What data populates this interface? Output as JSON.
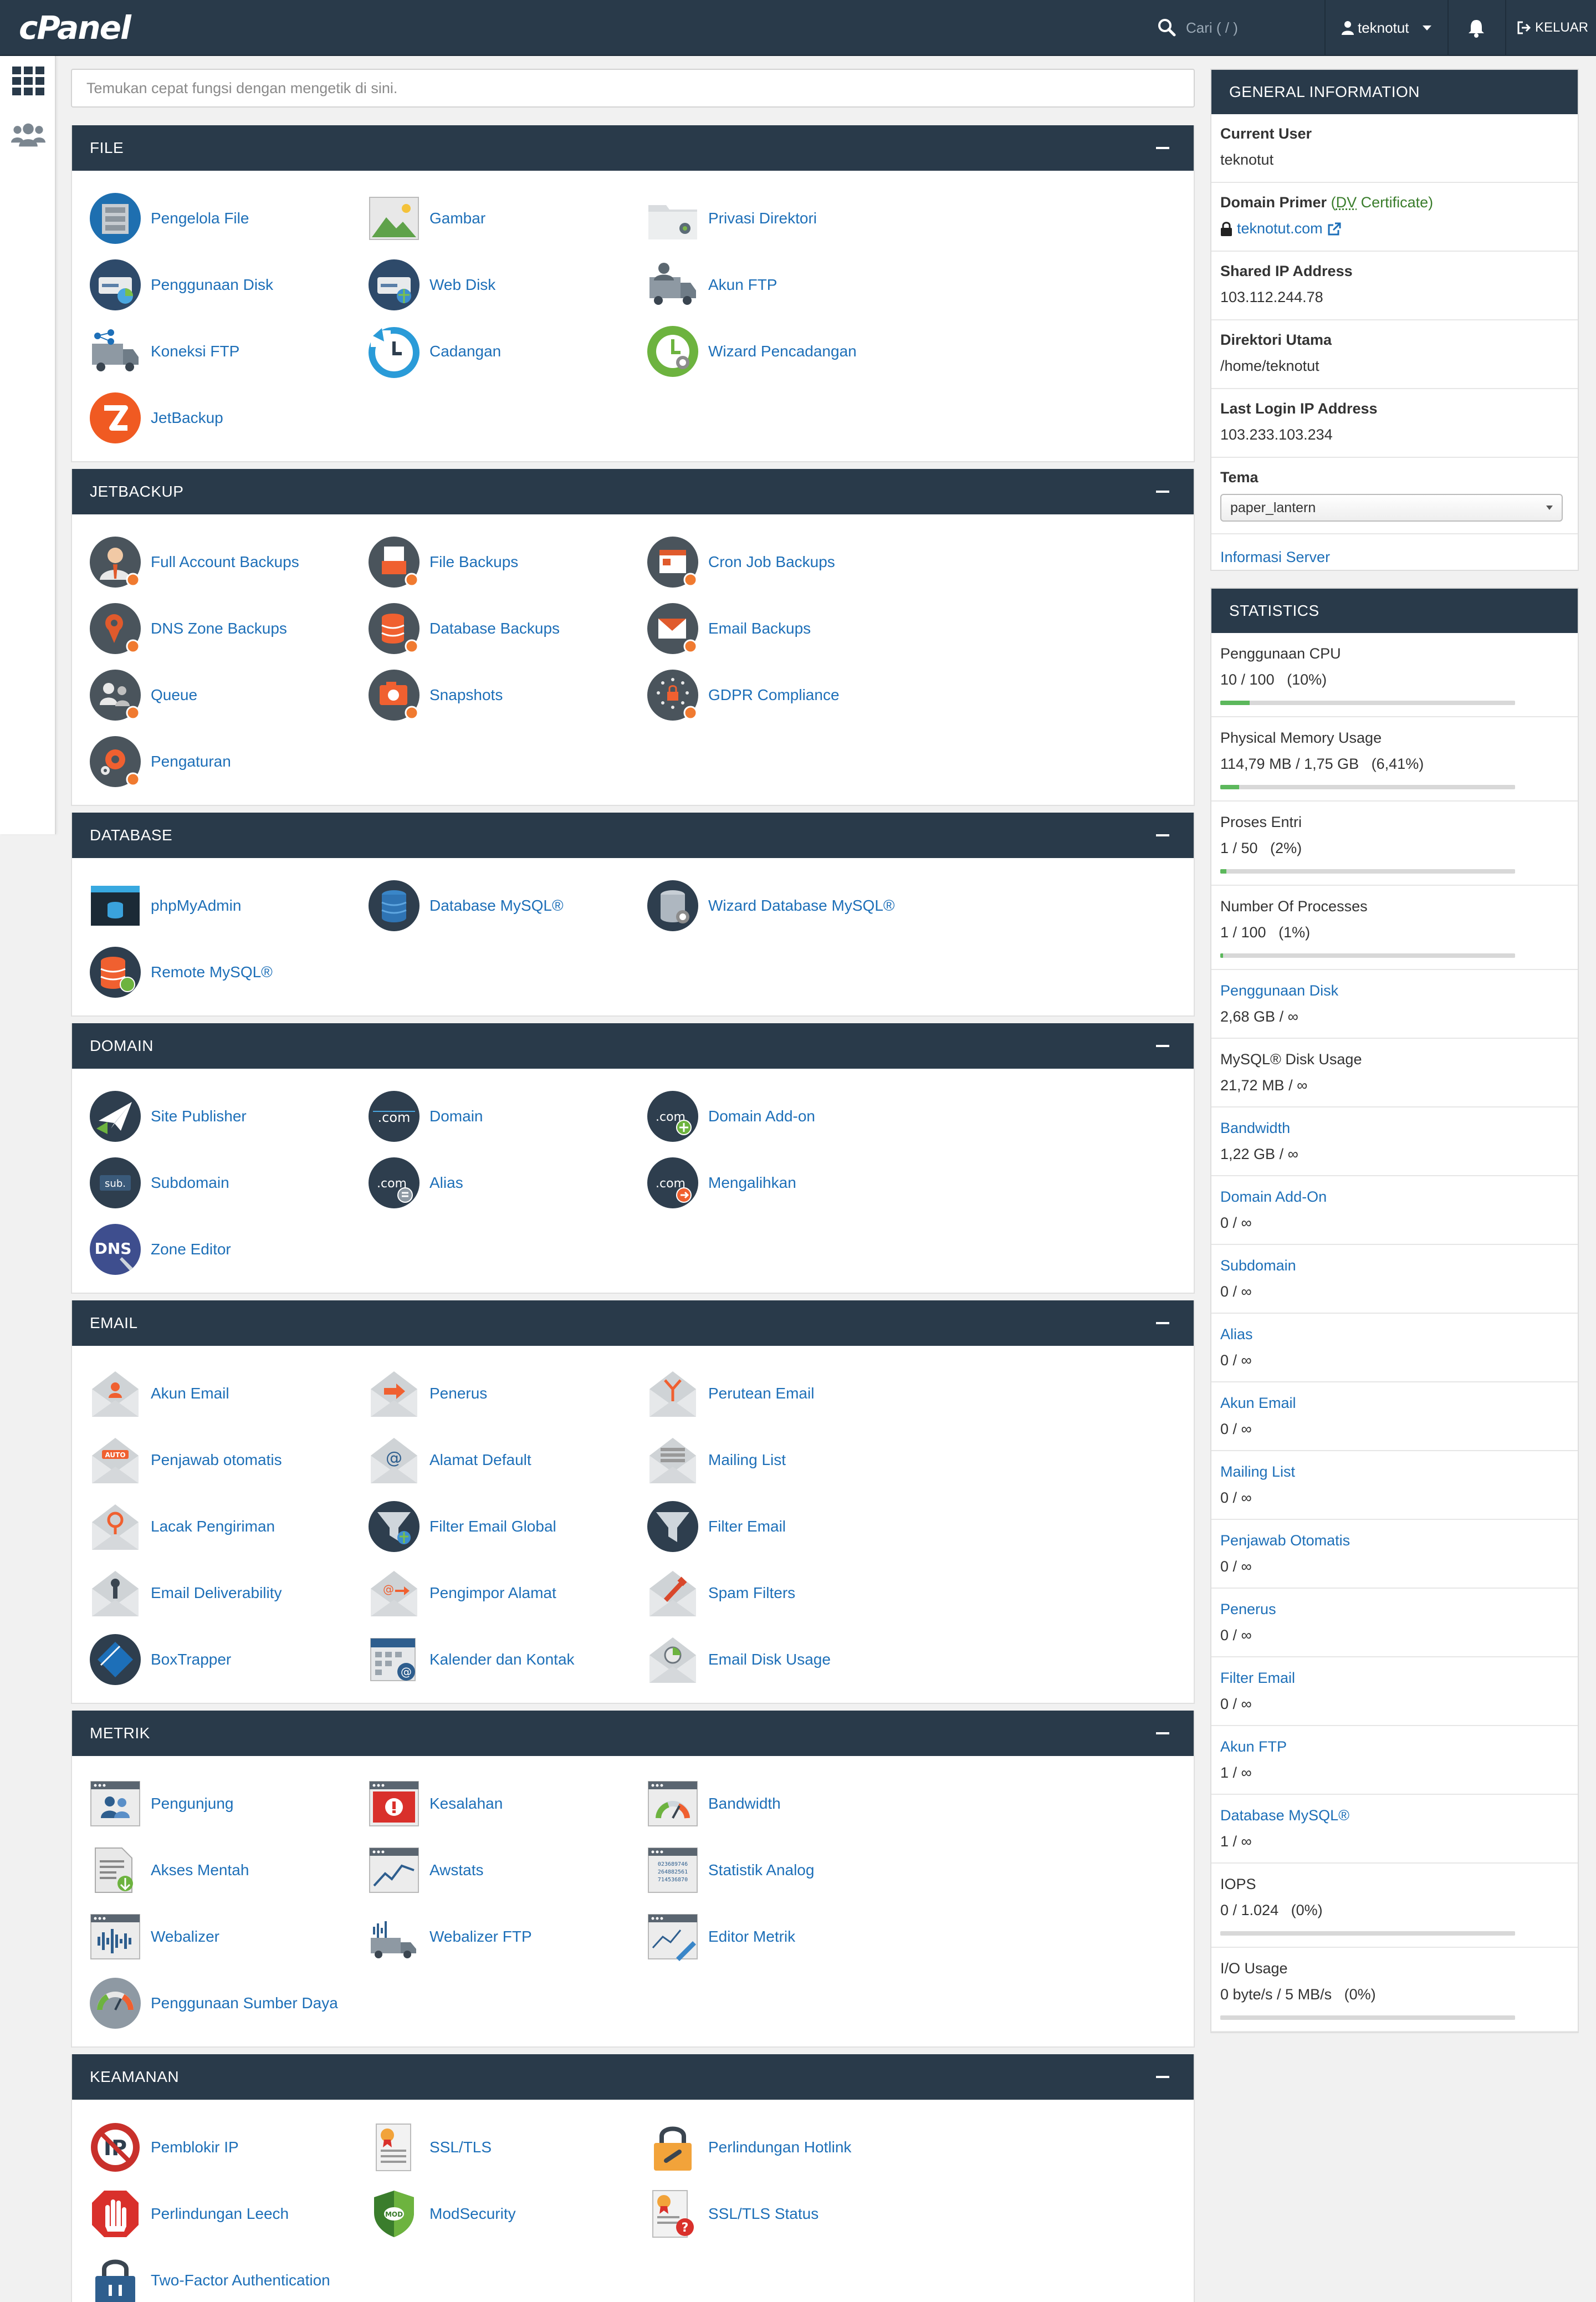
{
  "app": {
    "logo": "cPanel",
    "search_placeholder": "Cari ( / )",
    "username": "teknotut",
    "logout_label": "KELUAR"
  },
  "quick_search_placeholder": "Temukan cepat fungsi dengan mengetik di sini.",
  "sections": [
    {
      "title": "FILE",
      "items": [
        {
          "label": "Pengelola File",
          "icon": "file-manager-icon"
        },
        {
          "label": "Gambar",
          "icon": "images-icon"
        },
        {
          "label": "Privasi Direktori",
          "icon": "directory-privacy-icon"
        },
        {
          "label": "Penggunaan Disk",
          "icon": "disk-usage-icon"
        },
        {
          "label": "Web Disk",
          "icon": "web-disk-icon"
        },
        {
          "label": "Akun FTP",
          "icon": "ftp-accounts-icon"
        },
        {
          "label": "Koneksi FTP",
          "icon": "ftp-connections-icon"
        },
        {
          "label": "Cadangan",
          "icon": "backup-icon"
        },
        {
          "label": "Wizard Pencadangan",
          "icon": "backup-wizard-icon"
        },
        {
          "label": "JetBackup",
          "icon": "jetbackup-icon"
        }
      ]
    },
    {
      "title": "JETBACKUP",
      "items": [
        {
          "label": "Full Account Backups",
          "icon": "full-account-backups-icon"
        },
        {
          "label": "File Backups",
          "icon": "file-backups-icon"
        },
        {
          "label": "Cron Job Backups",
          "icon": "cron-job-backups-icon"
        },
        {
          "label": "DNS Zone Backups",
          "icon": "dns-zone-backups-icon"
        },
        {
          "label": "Database Backups",
          "icon": "database-backups-icon"
        },
        {
          "label": "Email Backups",
          "icon": "email-backups-icon"
        },
        {
          "label": "Queue",
          "icon": "queue-icon"
        },
        {
          "label": "Snapshots",
          "icon": "snapshots-icon"
        },
        {
          "label": "GDPR Compliance",
          "icon": "gdpr-compliance-icon"
        },
        {
          "label": "Pengaturan",
          "icon": "settings-icon"
        }
      ]
    },
    {
      "title": "DATABASE",
      "items": [
        {
          "label": "phpMyAdmin",
          "icon": "phpmyadmin-icon"
        },
        {
          "label": "Database MySQL®",
          "icon": "mysql-databases-icon"
        },
        {
          "label": "Wizard Database MySQL®",
          "icon": "mysql-database-wizard-icon"
        },
        {
          "label": "Remote MySQL®",
          "icon": "remote-mysql-icon"
        }
      ]
    },
    {
      "title": "DOMAIN",
      "items": [
        {
          "label": "Site Publisher",
          "icon": "site-publisher-icon"
        },
        {
          "label": "Domain",
          "icon": "domains-icon"
        },
        {
          "label": "Domain Add-on",
          "icon": "addon-domains-icon"
        },
        {
          "label": "Subdomain",
          "icon": "subdomains-icon"
        },
        {
          "label": "Alias",
          "icon": "aliases-icon"
        },
        {
          "label": "Mengalihkan",
          "icon": "redirects-icon"
        },
        {
          "label": "Zone Editor",
          "icon": "zone-editor-icon"
        }
      ]
    },
    {
      "title": "EMAIL",
      "items": [
        {
          "label": "Akun Email",
          "icon": "email-accounts-icon"
        },
        {
          "label": "Penerus",
          "icon": "forwarders-icon"
        },
        {
          "label": "Perutean Email",
          "icon": "email-routing-icon"
        },
        {
          "label": "Penjawab otomatis",
          "icon": "autoresponders-icon"
        },
        {
          "label": "Alamat Default",
          "icon": "default-address-icon"
        },
        {
          "label": "Mailing List",
          "icon": "mailing-lists-icon"
        },
        {
          "label": "Lacak Pengiriman",
          "icon": "track-delivery-icon"
        },
        {
          "label": "Filter Email Global",
          "icon": "global-email-filters-icon"
        },
        {
          "label": "Filter Email",
          "icon": "email-filters-icon"
        },
        {
          "label": "Email Deliverability",
          "icon": "email-deliverability-icon"
        },
        {
          "label": "Pengimpor Alamat",
          "icon": "address-importer-icon"
        },
        {
          "label": "Spam Filters",
          "icon": "spam-filters-icon"
        },
        {
          "label": "BoxTrapper",
          "icon": "boxtrapper-icon"
        },
        {
          "label": "Kalender dan Kontak",
          "icon": "calendars-contacts-icon"
        },
        {
          "label": "Email Disk Usage",
          "icon": "email-disk-usage-icon"
        }
      ]
    },
    {
      "title": "METRIK",
      "items": [
        {
          "label": "Pengunjung",
          "icon": "visitors-icon"
        },
        {
          "label": "Kesalahan",
          "icon": "errors-icon"
        },
        {
          "label": "Bandwidth",
          "icon": "bandwidth-icon"
        },
        {
          "label": "Akses Mentah",
          "icon": "raw-access-icon"
        },
        {
          "label": "Awstats",
          "icon": "awstats-icon"
        },
        {
          "label": "Statistik Analog",
          "icon": "analog-stats-icon"
        },
        {
          "label": "Webalizer",
          "icon": "webalizer-icon"
        },
        {
          "label": "Webalizer FTP",
          "icon": "webalizer-ftp-icon"
        },
        {
          "label": "Editor Metrik",
          "icon": "metrics-editor-icon"
        },
        {
          "label": "Penggunaan Sumber Daya",
          "icon": "resource-usage-icon"
        }
      ]
    },
    {
      "title": "KEAMANAN",
      "items": [
        {
          "label": "Pemblokir IP",
          "icon": "ip-blocker-icon"
        },
        {
          "label": "SSL/TLS",
          "icon": "ssl-tls-icon"
        },
        {
          "label": "Perlindungan Hotlink",
          "icon": "hotlink-protection-icon"
        },
        {
          "label": "Perlindungan Leech",
          "icon": "leech-protection-icon"
        },
        {
          "label": "ModSecurity",
          "icon": "modsecurity-icon"
        },
        {
          "label": "SSL/TLS Status",
          "icon": "ssl-tls-status-icon"
        },
        {
          "label": "Two-Factor Authentication",
          "icon": "two-factor-auth-icon"
        }
      ]
    }
  ],
  "general_info": {
    "title": "GENERAL INFORMATION",
    "current_user_label": "Current User",
    "current_user": "teknotut",
    "primary_domain_label": "Domain Primer",
    "cert_open": "(",
    "cert_dv": "DV",
    "cert_rest": " Certificate)",
    "primary_domain": "teknotut.com",
    "shared_ip_label": "Shared IP Address",
    "shared_ip": "103.112.244.78",
    "home_dir_label": "Direktori Utama",
    "home_dir": "/home/teknotut",
    "last_login_label": "Last Login IP Address",
    "last_login_ip": "103.233.103.234",
    "theme_label": "Tema",
    "theme": "paper_lantern",
    "server_info_link": "Informasi Server"
  },
  "statistics": {
    "title": "STATISTICS",
    "rows": [
      {
        "label": "Penggunaan CPU",
        "value": "10 / 100   (10%)",
        "link": false,
        "percent": 10
      },
      {
        "label": "Physical Memory Usage",
        "value": "114,79 MB / 1,75 GB   (6,41%)",
        "link": false,
        "percent": 6.41
      },
      {
        "label": "Proses Entri",
        "value": "1 / 50   (2%)",
        "link": false,
        "percent": 2
      },
      {
        "label": "Number Of Processes",
        "value": "1 / 100   (1%)",
        "link": false,
        "percent": 1
      },
      {
        "label": "Penggunaan Disk",
        "value": "2,68 GB / ∞",
        "link": true
      },
      {
        "label": "MySQL® Disk Usage",
        "value": "21,72 MB / ∞",
        "link": false
      },
      {
        "label": "Bandwidth",
        "value": "1,22 GB / ∞",
        "link": true
      },
      {
        "label": "Domain Add-On",
        "value": "0 / ∞",
        "link": true
      },
      {
        "label": "Subdomain",
        "value": "0 / ∞",
        "link": true
      },
      {
        "label": "Alias",
        "value": "0 / ∞",
        "link": true
      },
      {
        "label": "Akun Email",
        "value": "0 / ∞",
        "link": true
      },
      {
        "label": "Mailing List",
        "value": "0 / ∞",
        "link": true
      },
      {
        "label": "Penjawab Otomatis",
        "value": "0 / ∞",
        "link": true
      },
      {
        "label": "Penerus",
        "value": "0 / ∞",
        "link": true
      },
      {
        "label": "Filter Email",
        "value": "0 / ∞",
        "link": true
      },
      {
        "label": "Akun FTP",
        "value": "1 / ∞",
        "link": true
      },
      {
        "label": "Database MySQL®",
        "value": "1 / ∞",
        "link": true
      },
      {
        "label": "IOPS",
        "value": "0 / 1.024   (0%)",
        "link": false,
        "percent": 0
      },
      {
        "label": "I/O Usage",
        "value": "0 byte/s / 5 MB/s   (0%)",
        "link": false,
        "percent": 0
      }
    ]
  },
  "colors": {
    "header": "#293a4a",
    "link": "#1d6fb8",
    "bar_fill": "#5cb85c"
  }
}
